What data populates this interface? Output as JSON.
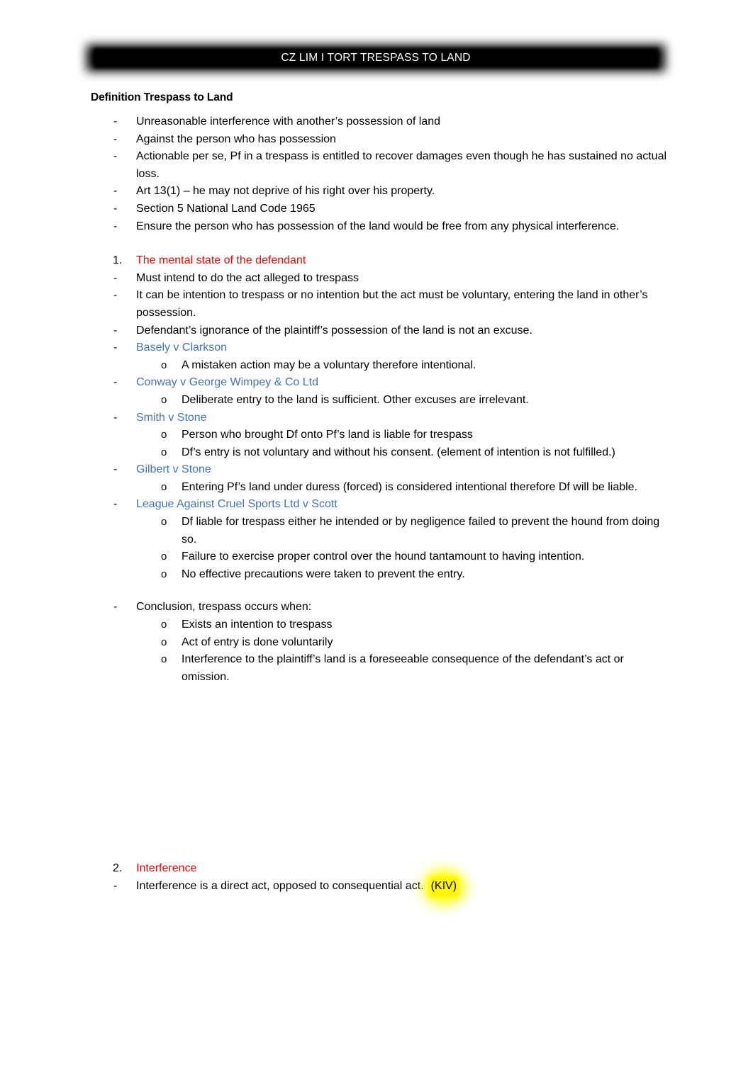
{
  "header": {
    "title": "CZ LIM I TORT TRESPASS TO LAND"
  },
  "colors": {
    "heading_red": "#FF0000",
    "case_blue": "#4472C4",
    "highlight_yellow": "#FFFF00",
    "banner_black": "#000000",
    "body_black": "#000000"
  },
  "document": {
    "section_heading": "Definition Trespass to Land",
    "definition_bullets": [
      "Unreasonable interference with another’s possession of land",
      "Against the person who has possession",
      "Actionable per se, Pf in a trespass is entitled to recover damages even though he has sustained no actual loss.",
      "Art 13(1) – he may not deprive of his right over his property.",
      "Section 5 National Land Code 1965",
      "Ensure the person who has possession of the land would be free from any physical interference."
    ],
    "section_1": {
      "number": "1.",
      "title": "The mental state of the defendant",
      "points": [
        "Must intend to do the act alleged to trespass",
        "It can be intention to trespass or no intention but the act must be voluntary, entering the land in other’s possession.",
        "Defendant’s ignorance of the plaintiff’s possession of the land is not an excuse."
      ],
      "cases": [
        {
          "name": "Basely v Clarkson",
          "holdings": [
            "A mistaken action may be a voluntary therefore intentional."
          ]
        },
        {
          "name": "Conway v George Wimpey & Co Ltd",
          "holdings": [
            "Deliberate entry to the land is sufficient. Other excuses are irrelevant."
          ]
        },
        {
          "name": "Smith v Stone",
          "holdings": [
            "Person who brought Df onto Pf’s land is liable for trespass",
            "Df’s entry is not voluntary and without his consent. (element of intention is not fulfilled.)"
          ]
        },
        {
          "name": "Gilbert v Stone",
          "holdings": [
            "Entering Pf’s land under duress (forced) is considered intentional therefore Df will be liable."
          ]
        },
        {
          "name": "League Against Cruel Sports Ltd v Scott",
          "holdings": [
            "Df liable for trespass either he intended or by negligence failed to prevent the hound from doing so.",
            "Failure to exercise proper control over the hound tantamount to having intention.",
            "No effective precautions were taken to prevent the entry."
          ]
        }
      ],
      "conclusion": {
        "lead": "Conclusion, trespass occurs when:",
        "items": [
          "Exists an intention to trespass",
          "Act of entry is done voluntarily",
          "Interference to the plaintiff’s land is a foreseeable consequence of the defendant’s act or omission."
        ]
      }
    },
    "section_2": {
      "number": "2.",
      "title": "Interference",
      "points": [
        "Interference is a direct act, opposed to consequential act."
      ],
      "highlight_note": "(KIV)"
    },
    "markers": {
      "dash": "-",
      "circle": "o"
    }
  }
}
